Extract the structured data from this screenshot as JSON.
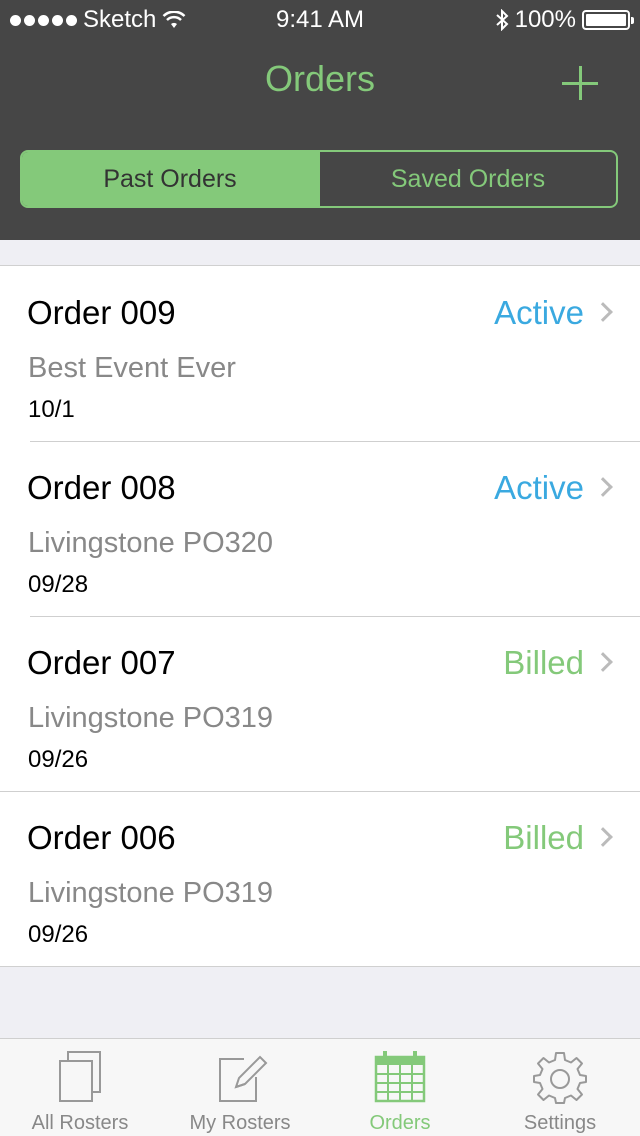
{
  "status_bar": {
    "carrier": "Sketch",
    "time": "9:41 AM",
    "battery": "100%"
  },
  "nav": {
    "title": "Orders",
    "add_icon": "plus-icon"
  },
  "segments": [
    {
      "label": "Past Orders",
      "selected": true
    },
    {
      "label": "Saved Orders",
      "selected": false
    }
  ],
  "orders": [
    {
      "title": "Order 009",
      "name": "Best Event Ever",
      "date": "10/1",
      "status": "Active"
    },
    {
      "title": "Order 008",
      "name": "Livingstone PO320",
      "date": "09/28",
      "status": "Active"
    },
    {
      "title": "Order 007",
      "name": "Livingstone PO319",
      "date": "09/26",
      "status": "Billed"
    },
    {
      "title": "Order 006",
      "name": "Livingstone PO319",
      "date": "09/26",
      "status": "Billed"
    }
  ],
  "tabs": [
    {
      "label": "All Rosters",
      "icon": "documents-icon"
    },
    {
      "label": "My Rosters",
      "icon": "edit-icon"
    },
    {
      "label": "Orders",
      "icon": "calendar-icon",
      "selected": true
    },
    {
      "label": "Settings",
      "icon": "gear-icon"
    }
  ],
  "colors": {
    "header_bg": "#464646",
    "accent_green": "#84c97a",
    "active_blue": "#3aa9e0"
  }
}
